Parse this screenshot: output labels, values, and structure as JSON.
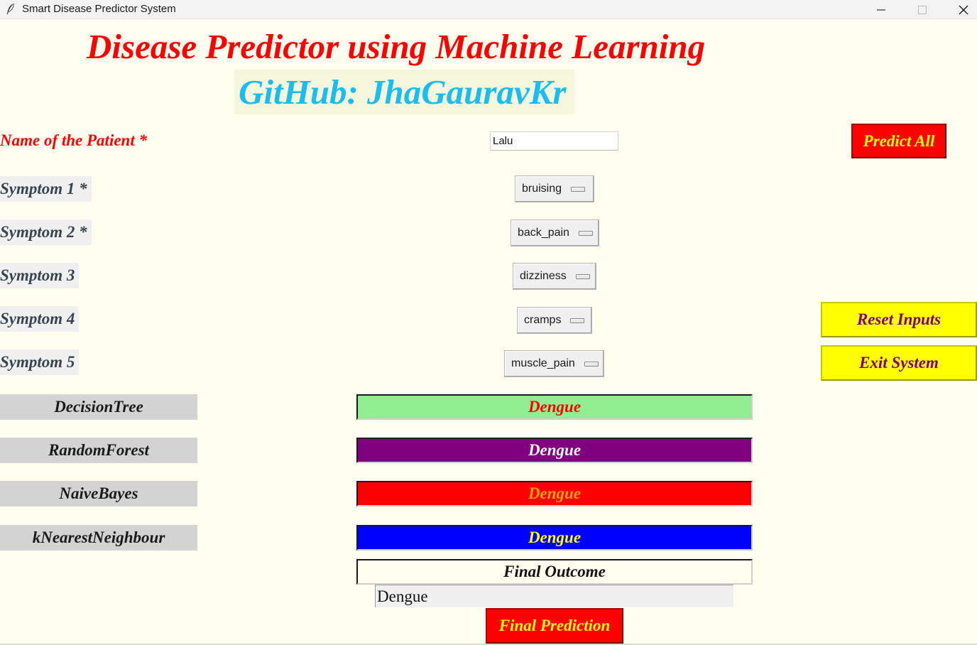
{
  "window": {
    "title": "Smart Disease Predictor System"
  },
  "header": {
    "main_title": "Disease Predictor using Machine Learning",
    "github": "GitHub: JhaGauravKr"
  },
  "patient": {
    "label": "Name of the Patient *",
    "value": "Lalu"
  },
  "symptoms": [
    {
      "label": "Symptom 1 *",
      "value": "bruising"
    },
    {
      "label": "Symptom 2 *",
      "value": "back_pain"
    },
    {
      "label": "Symptom 3",
      "value": "dizziness"
    },
    {
      "label": "Symptom 4",
      "value": "cramps"
    },
    {
      "label": "Symptom 5",
      "value": "muscle_pain"
    }
  ],
  "buttons": {
    "predict_all": "Predict All",
    "reset": "Reset Inputs",
    "exit": "Exit System",
    "final_prediction": "Final Prediction"
  },
  "algorithms": [
    {
      "label": "DecisionTree",
      "result": "Dengue",
      "bg": "#90ee90",
      "fg": "#ff0000"
    },
    {
      "label": "RandomForest",
      "result": "Dengue",
      "bg": "#800080",
      "fg": "#ffffff"
    },
    {
      "label": "NaiveBayes",
      "result": "Dengue",
      "bg": "#ff0000",
      "fg": "#ffa500"
    },
    {
      "label": "kNearestNeighbour",
      "result": "Dengue",
      "bg": "#0000ff",
      "fg": "#ffff00"
    }
  ],
  "final": {
    "label": "Final Outcome",
    "value": "Dengue"
  },
  "colors": {
    "background": "#fffff0",
    "title": "#ff0000",
    "github": "#1bbcf0",
    "symptom_label": "#36454f"
  },
  "icons": {
    "app": "feather-icon",
    "minimize": "minimize-icon",
    "maximize": "maximize-icon",
    "close": "close-icon"
  }
}
